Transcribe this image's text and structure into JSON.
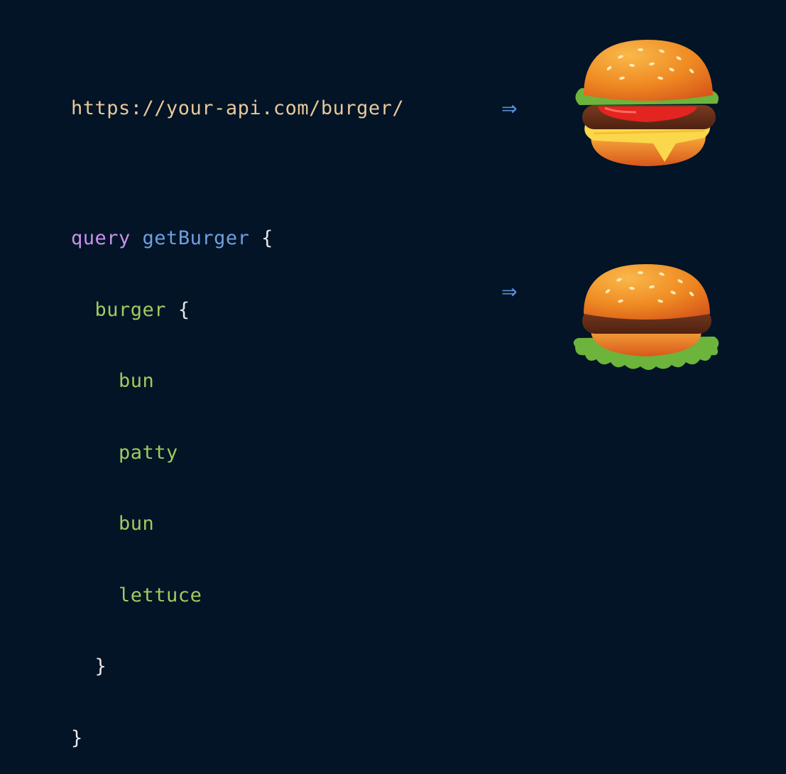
{
  "rest": {
    "url": "https://your-api.com/burger/",
    "arrow": "⇒",
    "result_icon": "cheeseburger-icon"
  },
  "graphql": {
    "keyword": "query",
    "operation": "getBurger",
    "open_brace": "{",
    "root_field": "burger",
    "fields": [
      "bun",
      "patty",
      "bun",
      "lettuce"
    ],
    "close_brace": "}",
    "arrow": "⇒",
    "result_icon": "upside-down-burger-icon"
  },
  "colors": {
    "background": "#021426",
    "url": "#e9c89a",
    "keyword": "#c792ea",
    "operation": "#6f9fe0",
    "field": "#9fcb5e",
    "arrow": "#5b8fdc"
  }
}
